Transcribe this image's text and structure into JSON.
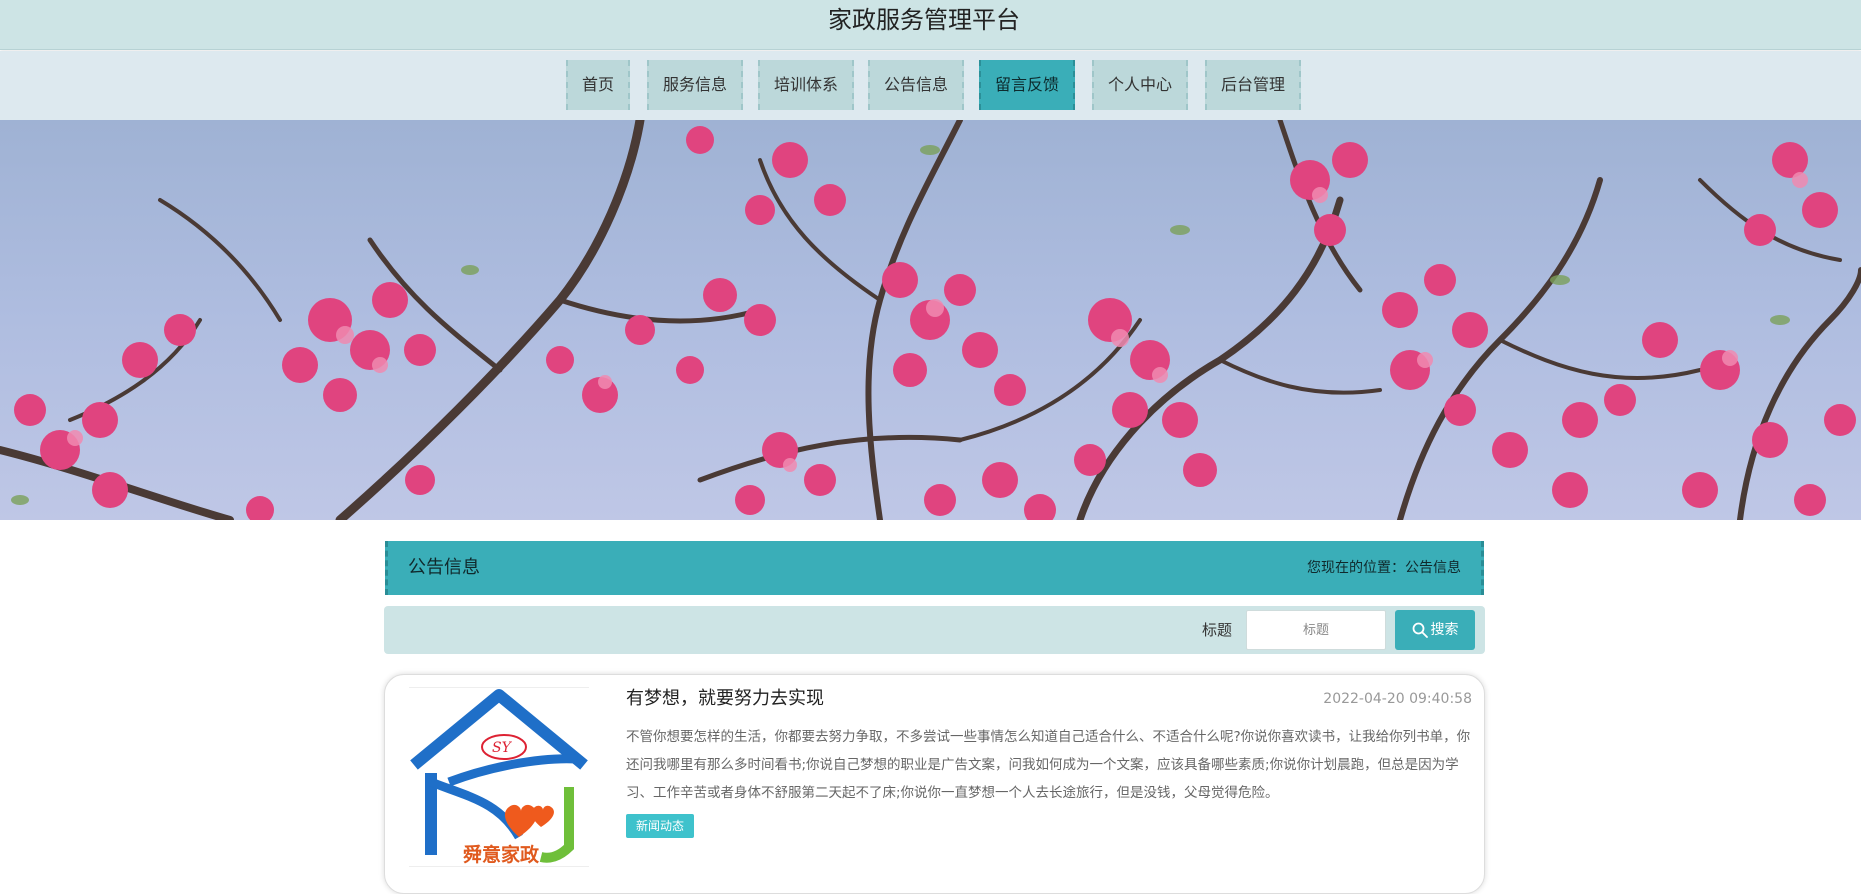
{
  "site": {
    "title": "家政服务管理平台"
  },
  "nav": {
    "items": [
      {
        "label": "首页"
      },
      {
        "label": "服务信息"
      },
      {
        "label": "培训体系"
      },
      {
        "label": "公告信息"
      },
      {
        "label": "留言反馈",
        "active": true
      },
      {
        "label": "个人中心"
      },
      {
        "label": "后台管理"
      }
    ]
  },
  "banner": {
    "image": "pink cherry blossom branches against blue sky"
  },
  "section": {
    "title": "公告信息",
    "location": "您现在的位置：公告信息"
  },
  "search": {
    "label": "标题",
    "placeholder": "标题",
    "button_label": "搜索"
  },
  "news": [
    {
      "title": "有梦想，就要努力去实现",
      "date": "2022-04-20 09:40:58",
      "excerpt": "不管你想要怎样的生活，你都要去努力争取，不多尝试一些事情怎么知道自己适合什么、不适合什么呢?你说你喜欢读书，让我给你列书单，你还问我哪里有那么多时间看书;你说自己梦想的职业是广告文案，问我如何成为一个文案，应该具备哪些素质;你说你计划晨跑，但总是因为学习、工作辛苦或者身体不舒服第二天起不了床;你说你一直梦想一个人去长途旅行，但是没钱，父母觉得危险。",
      "tag": "新闻动态",
      "thumb": {
        "logo_text": "舜意家政",
        "logo_mark": "SY"
      }
    }
  ],
  "colors": {
    "topbar": "#cde4e5",
    "navbar": "#dde9ef",
    "nav_item": "#bcd8da",
    "accent": "#3aaeb8",
    "tag": "#3ec2cc"
  },
  "icons": {
    "search": "magnifier-icon"
  }
}
